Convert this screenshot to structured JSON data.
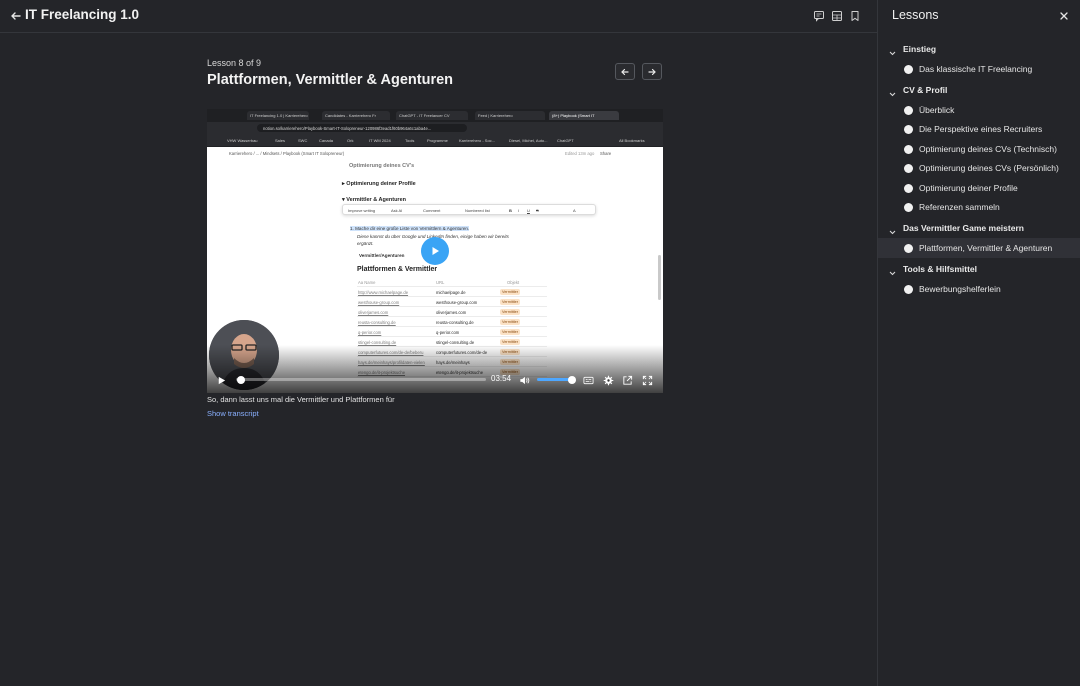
{
  "header": {
    "course_title": "IT Freelancing 1.0",
    "icons": [
      "arrow-left-icon",
      "comment-icon",
      "grid-icon",
      "bookmark-icon"
    ]
  },
  "lesson": {
    "counter": "Lesson 8 of 9",
    "title": "Plattformen, Vermittler & Agenturen"
  },
  "video": {
    "browser_tabs": [
      "IT Freelancing 1.0 | Karrierehero",
      "Candidates - Karrierehero Fr",
      "ChatGPT - IT Freelancer CV",
      "Feed | Karrierehero",
      "(8+) Playbook (Smart IT"
    ],
    "url": "notion.so/karrierehero/Playbook-Smart-IT-Solopreneur-120986f3ead1f60b964a6c1aba4e...",
    "bookmarks": [
      "VHW Wasserbau",
      "Sales",
      "SWC",
      "Canada",
      "Ork",
      "IT WM 2024",
      "Tools",
      "Programme",
      "Karrierehero - Soc...",
      "Diesel, Michel, Auto...",
      "ChatGPT",
      "All Bookmarks"
    ],
    "breadcrumb": "Karrierehero / ... / Mindsets / Playbook (Smart IT Solopreneur)",
    "edited": "Edited 13m ago",
    "share": "Share",
    "doc_heading_top": "Optimierung deines CV's",
    "doc_toggle_1": "Optimierung deiner Profile",
    "doc_toggle_2": "Vermittler & Agenturen",
    "toolbar_items": [
      "Improve writing",
      "Ask AI",
      "Comment",
      "Numbered list",
      "B",
      "I",
      "U",
      "S",
      "A"
    ],
    "highlight_line": "1. Mache dir eine große Liste von Vermittlern & Agenturen.",
    "italic_line_1": "Diese kannst du über Google und LinkedIn finden, einige haben wir bereits",
    "italic_line_2": "ergänzt.",
    "db_link": "Vermittler/Agenturen",
    "table_title": "Plattformen & Vermittler",
    "table_headers": [
      "Aa Name",
      "URL",
      "Objekt"
    ],
    "table_rows": [
      {
        "name": "http://www.michaelpage.de",
        "url": "michaelpage.de",
        "tag": "Vermittler"
      },
      {
        "name": "westhouse-group.com",
        "url": "westhouse-group.com",
        "tag": "Vermittler"
      },
      {
        "name": "oliverjames.com",
        "url": "oliverjames.com",
        "tag": "Vermittler"
      },
      {
        "name": "reusta-consulting.de",
        "url": "reusta-consulting.de",
        "tag": "Vermittler"
      },
      {
        "name": "q-perior.com",
        "url": "q-perior.com",
        "tag": "Vermittler"
      },
      {
        "name": "stingel-consulting.de",
        "url": "stingel-consulting.de",
        "tag": "Vermittler"
      },
      {
        "name": "computerfutures.com/de-de/beberu",
        "url": "computerfutures.com/de-de",
        "tag": "Vermittler"
      },
      {
        "name": "hays.de/meinhays/profildaten-vielen",
        "url": "hays.de/meinhays",
        "tag": "Vermittler"
      },
      {
        "name": "etengo.de/it-projektsuche",
        "url": "etengo.de/it-projektsuche",
        "tag": "Vermittler"
      }
    ],
    "time": "03:54",
    "progress_fraction": 0.02,
    "volume_fraction": 1.0,
    "caption": "So, dann lasst uns mal die Vermittler und Plattformen für",
    "show_transcript": "Show transcript"
  },
  "sidebar": {
    "title": "Lessons",
    "sections": [
      {
        "label": "Einstieg",
        "lessons": [
          "Das klassische IT Freelancing"
        ]
      },
      {
        "label": "CV & Profil",
        "lessons": [
          "Überblick",
          "Die Perspektive eines Recruiters",
          "Optimierung deines CVs (Technisch)",
          "Optimierung deines CVs (Persönlich)",
          "Optimierung deiner Profile",
          "Referenzen sammeln"
        ]
      },
      {
        "label": "Das Vermittler Game meistern",
        "lessons": [
          "Plattformen, Vermittler & Agenturen"
        ]
      },
      {
        "label": "Tools & Hilfsmittel",
        "lessons": [
          "Bewerbungshelferlein"
        ]
      }
    ],
    "active_lesson": "Plattformen, Vermittler & Agenturen"
  },
  "colors": {
    "background": "#242529",
    "accent_link": "#8ab0ff",
    "play_button": "#3aa4f5",
    "active_row": "#303137"
  }
}
